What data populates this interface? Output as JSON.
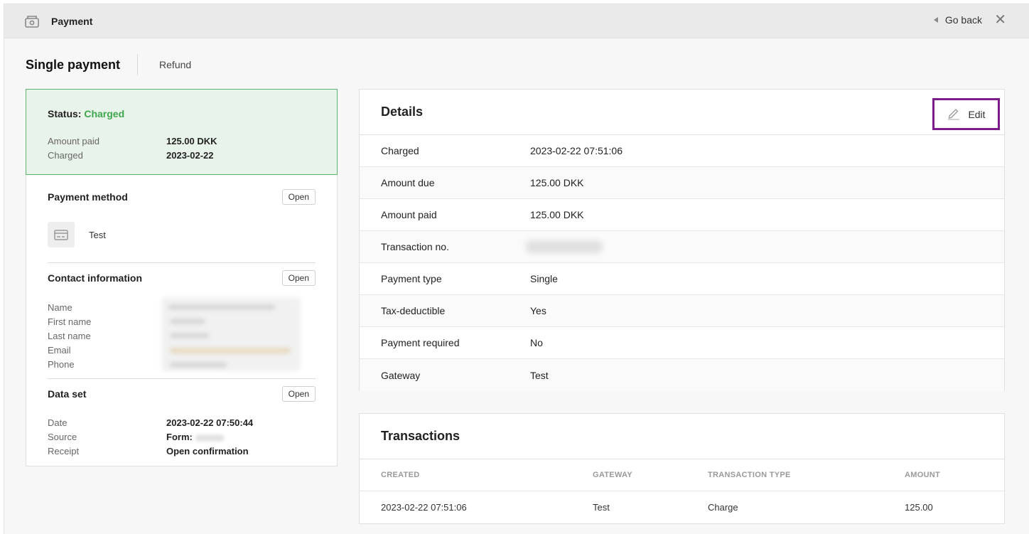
{
  "window": {
    "title": "Payment",
    "go_back": "Go back",
    "close": "✕"
  },
  "tabs": {
    "active": "Single payment",
    "inactive": "Refund"
  },
  "status": {
    "label": "Status:",
    "value": "Charged",
    "rows": [
      {
        "k": "Amount paid",
        "v": "125.00 DKK"
      },
      {
        "k": "Charged",
        "v": "2023-02-22"
      }
    ]
  },
  "payment_method": {
    "title": "Payment method",
    "open": "Open",
    "name": "Test"
  },
  "contact": {
    "title": "Contact information",
    "open": "Open",
    "labels": [
      "Name",
      "First name",
      "Last name",
      "Email",
      "Phone"
    ]
  },
  "dataset": {
    "title": "Data set",
    "open": "Open",
    "date_label": "Date",
    "date_value": "2023-02-22 07:50:44",
    "source_label": "Source",
    "source_value": "Form:",
    "receipt_label": "Receipt",
    "receipt_value": "Open confirmation"
  },
  "details": {
    "title": "Details",
    "edit": "Edit",
    "rows": [
      {
        "k": "Charged",
        "v": "2023-02-22 07:51:06"
      },
      {
        "k": "Amount due",
        "v": "125.00 DKK"
      },
      {
        "k": "Amount paid",
        "v": "125.00 DKK"
      },
      {
        "k": "Transaction no.",
        "v": ""
      },
      {
        "k": "Payment type",
        "v": "Single"
      },
      {
        "k": "Tax-deductible",
        "v": "Yes"
      },
      {
        "k": "Payment required",
        "v": "No"
      },
      {
        "k": "Gateway",
        "v": "Test"
      }
    ]
  },
  "transactions": {
    "title": "Transactions",
    "columns": [
      "CREATED",
      "GATEWAY",
      "TRANSACTION TYPE",
      "AMOUNT"
    ],
    "rows": [
      [
        "2023-02-22 07:51:06",
        "Test",
        "Charge",
        "125.00"
      ]
    ]
  },
  "colors": {
    "accent_green": "#3ea64d",
    "status_bg": "#e8f3ea",
    "link_gold": "#b08b47",
    "edit_highlight": "#7b1c8a"
  }
}
